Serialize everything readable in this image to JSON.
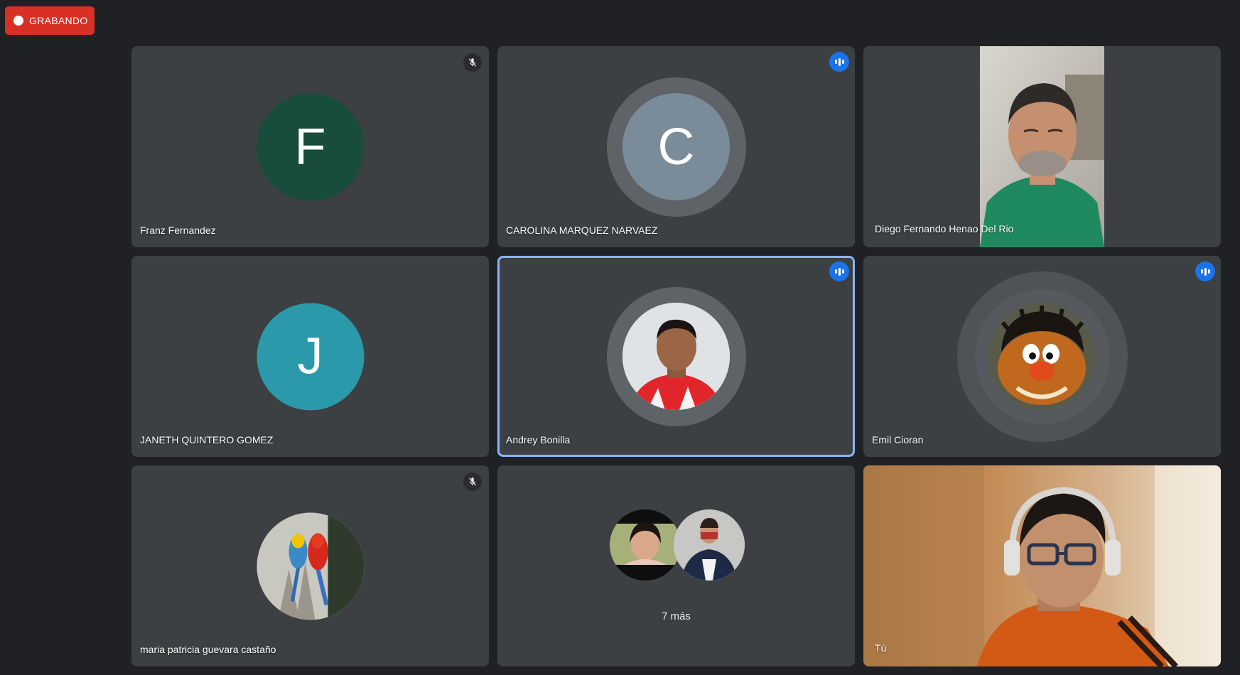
{
  "recording": {
    "label": "GRABANDO",
    "color": "#d93025"
  },
  "participants": [
    {
      "name": "Franz Fernandez",
      "initial": "F",
      "avatar_color": "#174d3a",
      "mic": "muted"
    },
    {
      "name": "CAROLINA MARQUEZ NARVAEZ",
      "initial": "C",
      "avatar_color": "#7a8b99",
      "mic": "speaking"
    },
    {
      "name": "Diego Fernando Henao Del Rio",
      "mic": "video"
    },
    {
      "name": "JANETH QUINTERO GOMEZ",
      "initial": "J",
      "avatar_color": "#2a9aaa"
    },
    {
      "name": "Andrey Bonilla",
      "mic": "speaking"
    },
    {
      "name": "Emil Cioran",
      "mic": "speaking"
    },
    {
      "name": "maria patricia guevara castaño",
      "mic": "muted"
    },
    {
      "more_label": "7 más"
    },
    {
      "name": "Tú"
    }
  ],
  "colors": {
    "background": "#202124",
    "tile": "#3c4043",
    "accent": "#1a73e8",
    "active_border": "#8ab4f8"
  }
}
